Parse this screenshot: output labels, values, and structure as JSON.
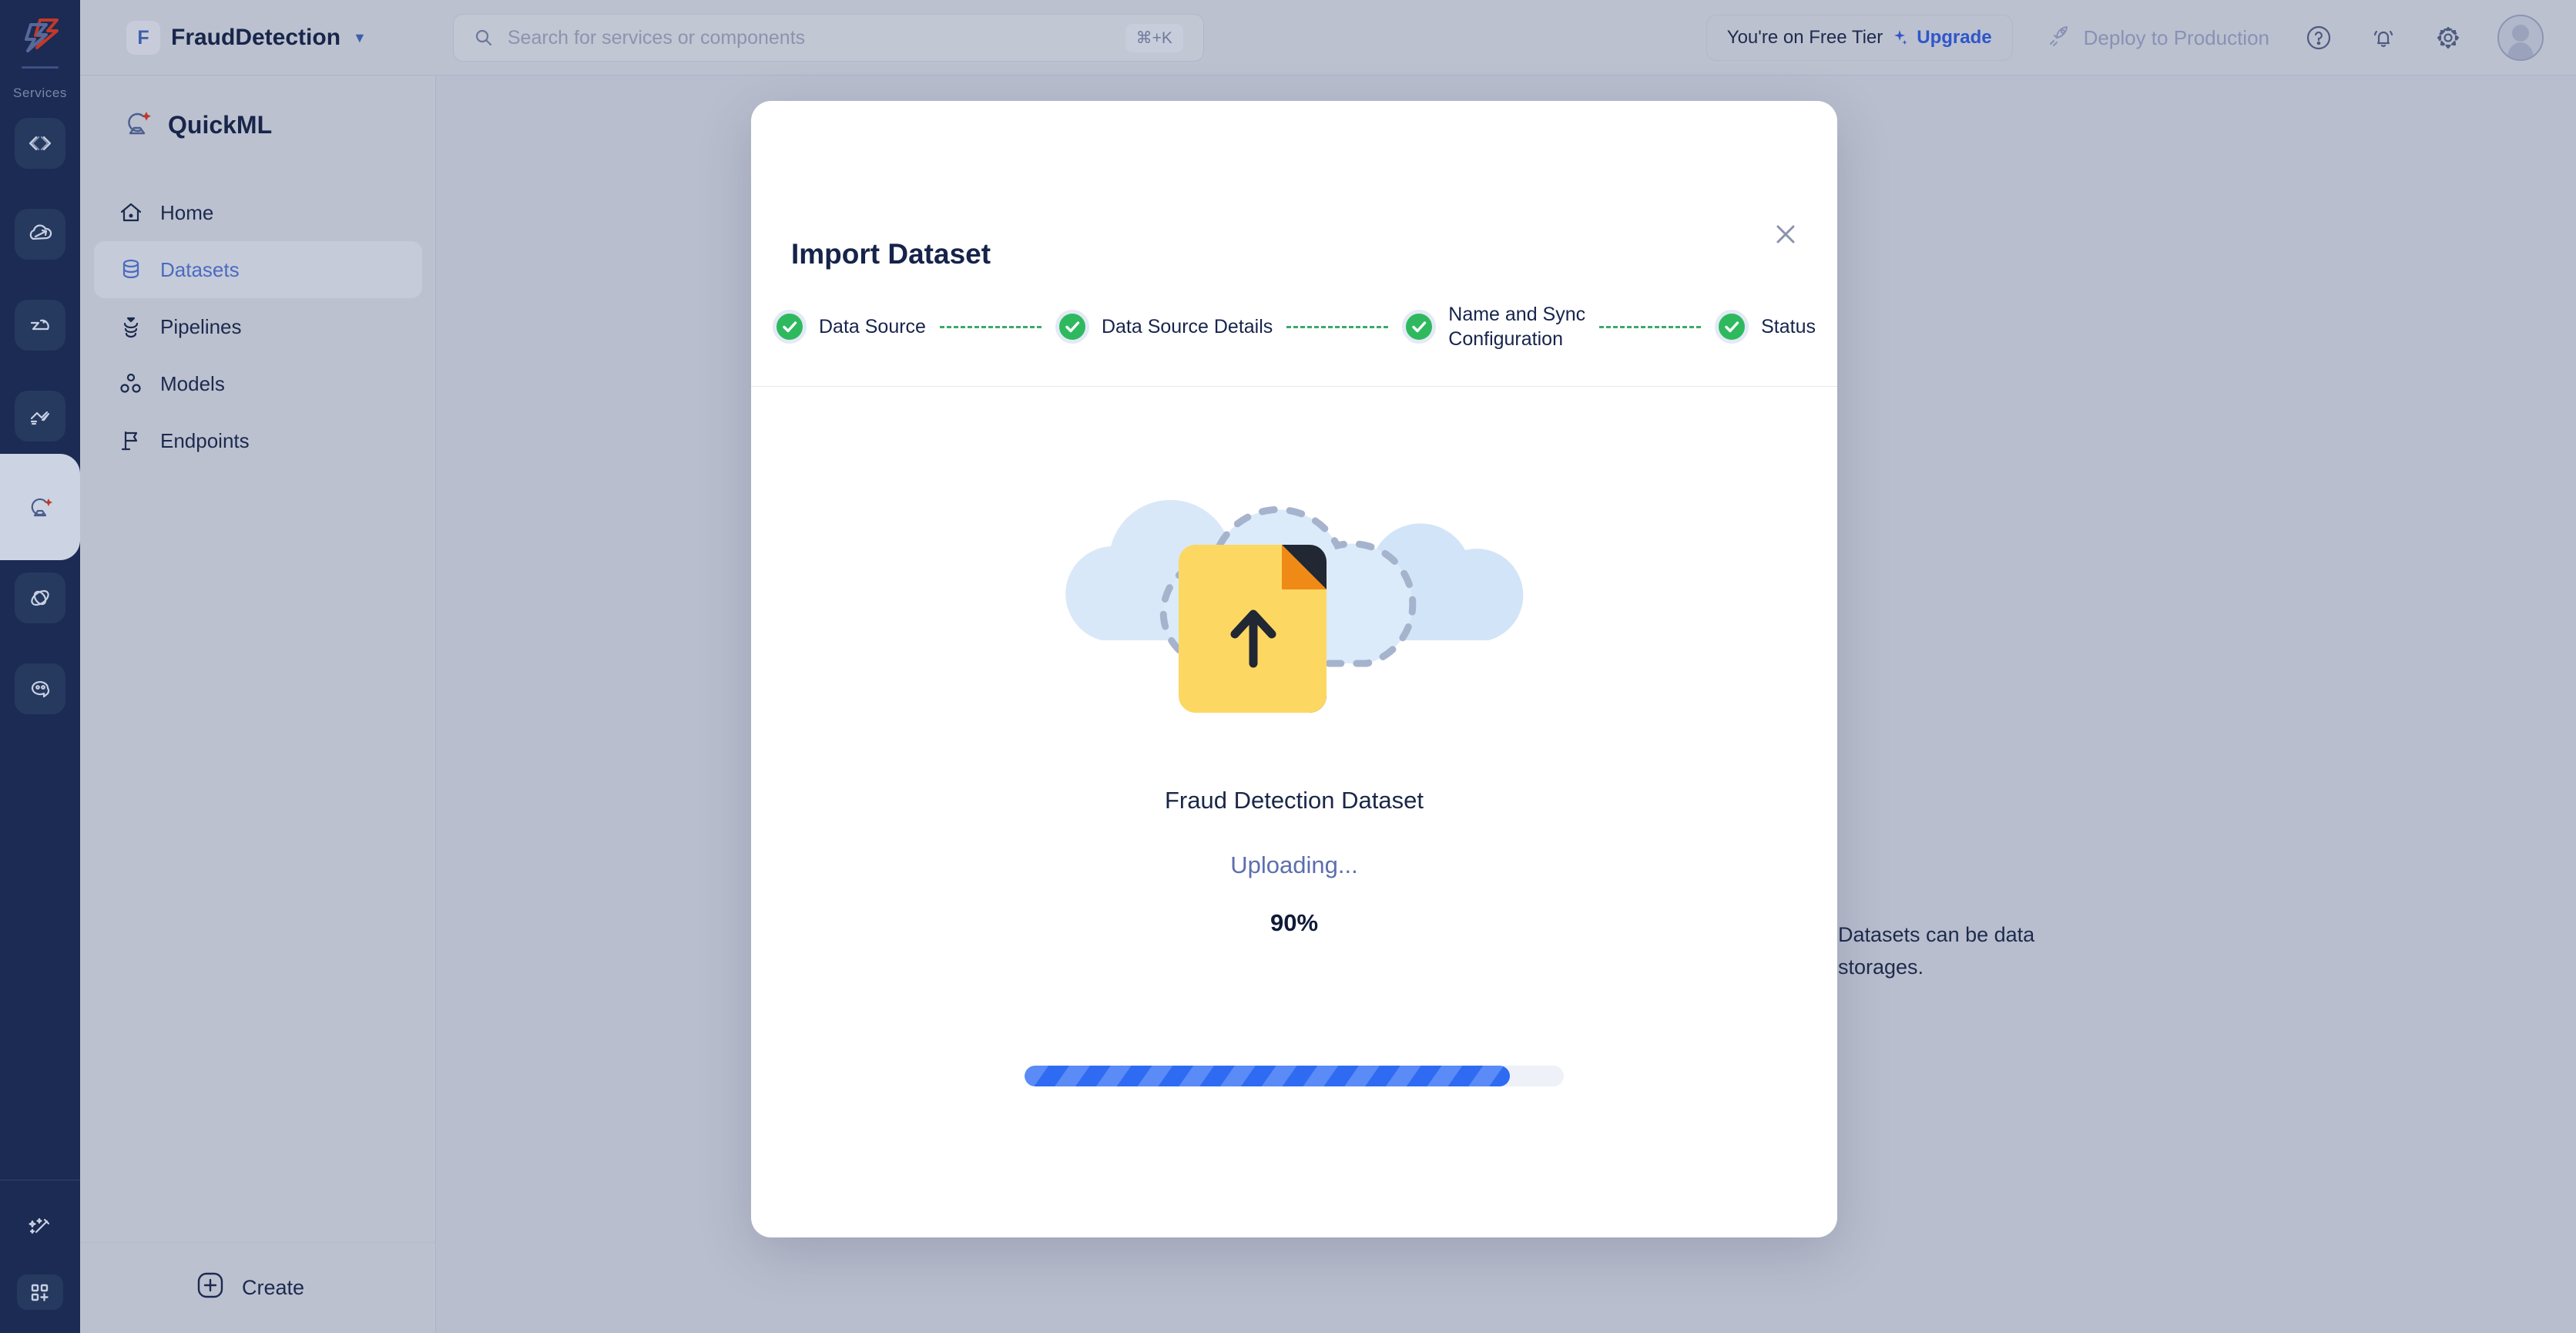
{
  "rail": {
    "logo_icon": "platform-logo-icon",
    "section_label": "Services",
    "items": [
      {
        "icon": "code-brackets-icon",
        "name": "service-code"
      },
      {
        "icon": "cloud-deploy-icon",
        "name": "service-cloud-deploy"
      },
      {
        "icon": "flow-icon",
        "name": "service-flow"
      },
      {
        "icon": "link-chain-icon",
        "name": "service-link"
      },
      {
        "icon": "quickml-satellite-icon",
        "name": "service-quickml",
        "active": true
      },
      {
        "icon": "orbit-icon",
        "name": "service-orbit"
      },
      {
        "icon": "chat-bubble-icon",
        "name": "service-chat"
      }
    ],
    "bottom_items": [
      {
        "icon": "magic-wand-icon",
        "name": "magic-wand"
      },
      {
        "icon": "add-widget-icon",
        "name": "add-widget"
      }
    ]
  },
  "header": {
    "project_initial": "F",
    "project_name": "FraudDetection",
    "project_caret_icon": "chevron-down-icon",
    "search": {
      "icon": "search-icon",
      "placeholder": "Search for services or components",
      "value": "",
      "shortcut": "⌘+K"
    },
    "tier": {
      "text": "You're on Free Tier",
      "upgrade_label": "Upgrade",
      "spark_icon": "sparkle-icon"
    },
    "deploy": {
      "label": "Deploy to Production",
      "icon": "rocket-icon"
    },
    "icons": [
      {
        "name": "help-icon",
        "glyph": "?"
      },
      {
        "name": "bell-icon",
        "glyph": "bell"
      },
      {
        "name": "gear-icon",
        "glyph": "gear"
      }
    ],
    "avatar_name": "user-avatar"
  },
  "sidebar": {
    "brand": {
      "name": "QuickML",
      "icon": "quickml-satellite-icon"
    },
    "items": [
      {
        "label": "Home",
        "icon": "home-icon",
        "active": false
      },
      {
        "label": "Datasets",
        "icon": "database-icon",
        "active": true
      },
      {
        "label": "Pipelines",
        "icon": "pipeline-icon",
        "active": false
      },
      {
        "label": "Models",
        "icon": "models-nodes-icon",
        "active": false
      },
      {
        "label": "Endpoints",
        "icon": "flag-icon",
        "active": false
      }
    ],
    "create": {
      "label": "Create",
      "icon": "plus-circle-icon"
    }
  },
  "main": {
    "hint_text": "Datasets can be data storages."
  },
  "modal": {
    "title": "Import Dataset",
    "close_icon": "close-icon",
    "steps": [
      {
        "label": "Data Source",
        "state": "complete"
      },
      {
        "label": "Data Source Details",
        "state": "complete"
      },
      {
        "label": "Name and Sync\nConfiguration",
        "state": "complete"
      },
      {
        "label": "Status",
        "state": "complete"
      }
    ],
    "illustration": "cloud-file-upload-illustration",
    "dataset_name": "Fraud Detection Dataset",
    "status_text": "Uploading...",
    "percent_text": "90%",
    "progress_value": 90,
    "colors": {
      "step_complete": "#2fb95f",
      "progress_fill": "#2f6bf2",
      "progress_stripe": "#5a8bf7",
      "progress_track": "#eef1f8",
      "accent_blue": "#2f56c9"
    }
  }
}
